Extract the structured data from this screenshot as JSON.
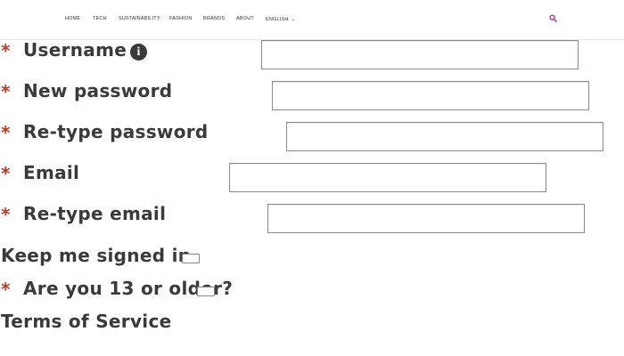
{
  "nav": {
    "items": [
      "HOME",
      "TECH",
      "SUSTAINABILITY",
      "FASHION",
      "BRANDS",
      "ABOUT"
    ],
    "language": "ENGLISH"
  },
  "icons": {
    "search": "search-icon",
    "info": "info-icon",
    "language_chevron": "chevron-down-icon"
  },
  "colors": {
    "search_icon": "#c81e8c",
    "required_marker": "#c0392b",
    "label_text": "#3a3a3a"
  },
  "form": {
    "required_marker": "*",
    "username": {
      "label": "Username",
      "value": ""
    },
    "new_password": {
      "label": "New password",
      "value": ""
    },
    "retype_password": {
      "label": "Re-type password",
      "value": ""
    },
    "email": {
      "label": "Email",
      "value": ""
    },
    "retype_email": {
      "label": "Re-type email",
      "value": ""
    },
    "keep_signed_in": {
      "label": "Keep me signed in",
      "checked": false
    },
    "age_check": {
      "label": "Are you 13 or older?",
      "checked": false
    },
    "terms_label": "Terms of Service"
  }
}
